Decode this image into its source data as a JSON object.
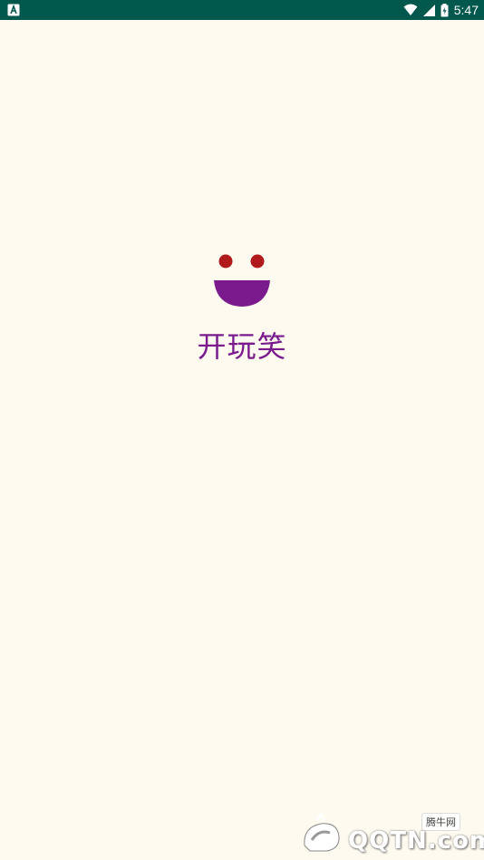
{
  "status_bar": {
    "time": "5:47",
    "left_icon": "notification-icon",
    "right_icons": [
      "wifi-icon",
      "signal-icon",
      "battery-icon"
    ],
    "background_color": "#00574b"
  },
  "splash": {
    "logo_icon": "smiley-icon",
    "app_name": "开玩笑",
    "brand_color": "#7a1a8c",
    "eye_color": "#b01a1a",
    "background_color": "#fefaef"
  },
  "watermark": {
    "cn_text": "腾牛网",
    "text": "QQTN.com"
  }
}
